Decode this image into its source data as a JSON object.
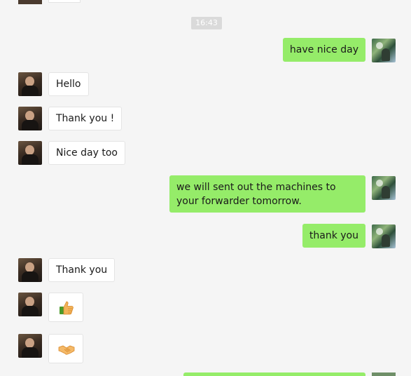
{
  "timestamp": "16:43",
  "messages": [
    {
      "side": "out",
      "text": "have nice day"
    },
    {
      "side": "in",
      "text": "Hello"
    },
    {
      "side": "in",
      "text": "Thank you !"
    },
    {
      "side": "in",
      "text": "Nice day too"
    },
    {
      "side": "out",
      "text": "we will  sent out the machines to your forwarder tomorrow."
    },
    {
      "side": "out",
      "text": "thank you"
    },
    {
      "side": "in",
      "text": "Thank you"
    },
    {
      "side": "in",
      "emoji": "thumbs-up"
    },
    {
      "side": "in",
      "emoji": "handshake"
    }
  ],
  "colors": {
    "background": "#f5f5f5",
    "outgoing_bubble": "#95ec69",
    "incoming_bubble": "#ffffff",
    "timestamp_bg": "#dadada"
  }
}
